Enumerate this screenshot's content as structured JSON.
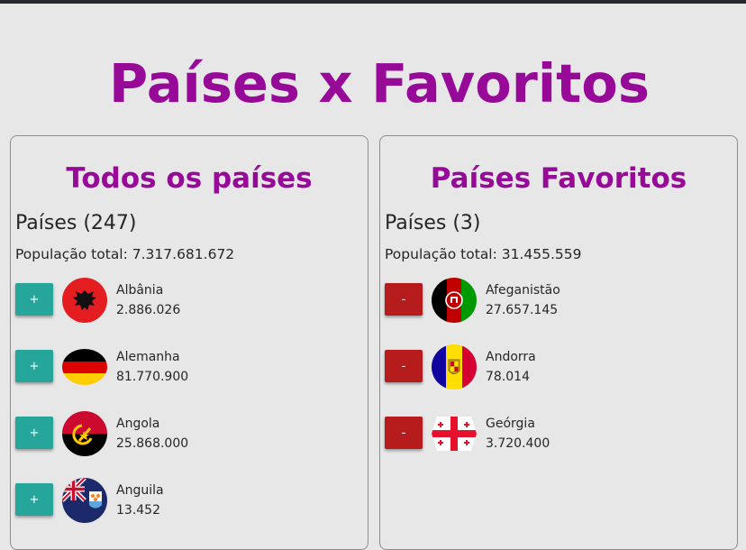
{
  "title": "Países x Favoritos",
  "colors": {
    "accent": "#970a98",
    "add_button": "#26a69a",
    "remove_button": "#b71c1c",
    "background": "#e7e7e8"
  },
  "all_countries": {
    "heading": "Todos os países",
    "count_label": "Países (247)",
    "population_label": "População total: 7.317.681.672",
    "button_label": "+",
    "items": [
      {
        "name": "Albânia",
        "population": "2.886.026",
        "flag": "albania-flag-icon"
      },
      {
        "name": "Alemanha",
        "population": "81.770.900",
        "flag": "germany-flag-icon"
      },
      {
        "name": "Angola",
        "population": "25.868.000",
        "flag": "angola-flag-icon"
      },
      {
        "name": "Anguila",
        "population": "13.452",
        "flag": "anguilla-flag-icon"
      }
    ]
  },
  "favorites": {
    "heading": "Países Favoritos",
    "count_label": "Países (3)",
    "population_label": "População total: 31.455.559",
    "button_label": "-",
    "items": [
      {
        "name": "Afeganistão",
        "population": "27.657.145",
        "flag": "afghanistan-flag-icon"
      },
      {
        "name": "Andorra",
        "population": "78.014",
        "flag": "andorra-flag-icon"
      },
      {
        "name": "Geórgia",
        "population": "3.720.400",
        "flag": "georgia-flag-icon"
      }
    ]
  }
}
